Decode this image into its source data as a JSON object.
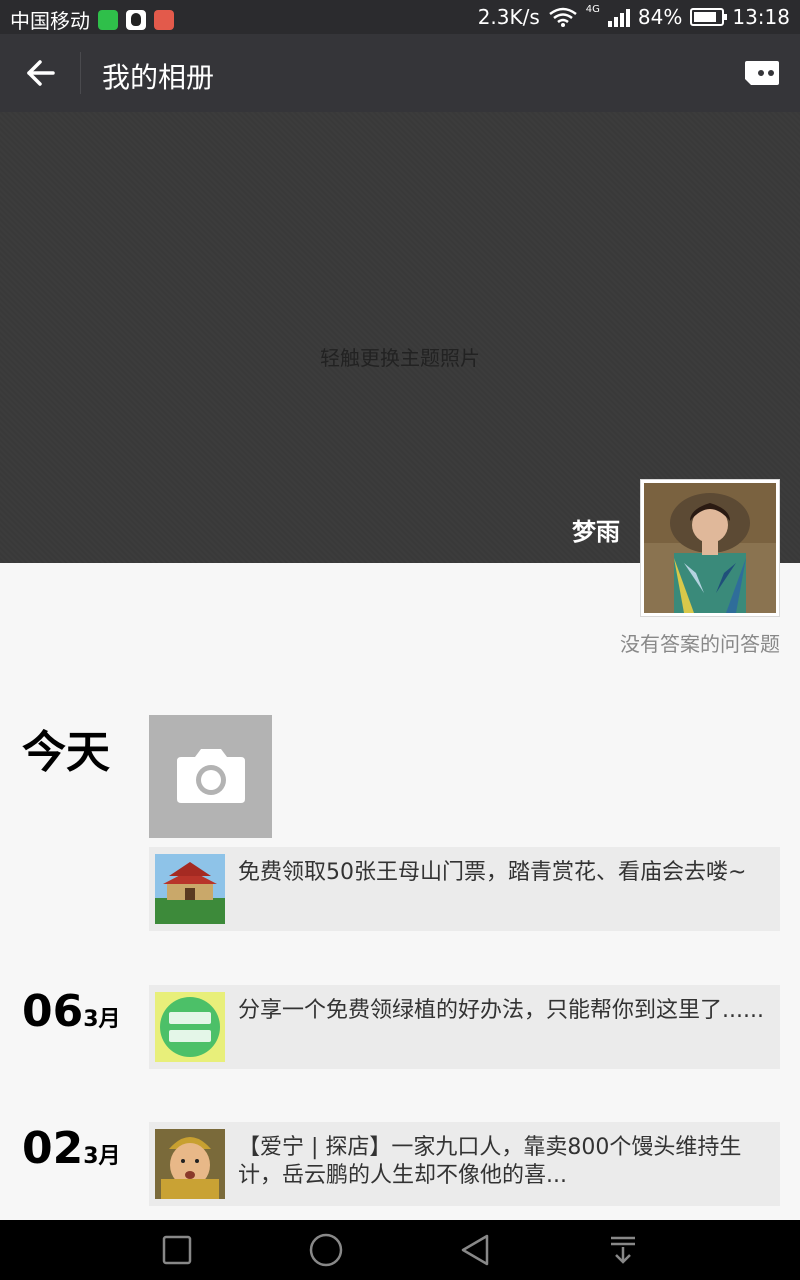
{
  "status_bar": {
    "carrier": "中国移动",
    "net_speed": "2.3K/s",
    "network_type": "4G",
    "battery": "84%",
    "battery_level": 0.84,
    "time": "13:18",
    "icons": [
      "app-green-icon",
      "qq-icon",
      "app-red-icon",
      "wifi-icon",
      "signal-icon",
      "battery-icon"
    ]
  },
  "action_bar": {
    "title": "我的相册",
    "back_icon": "back-arrow-icon",
    "more_icon": "more-chat-icon"
  },
  "cover": {
    "hint": "轻触更换主题照片",
    "username": "梦雨",
    "signature": "没有答案的问答题"
  },
  "timeline": {
    "today_label": "今天",
    "camera_icon": "camera-icon",
    "posts": [
      {
        "text": "免费领取50张王母山门票，踏青赏花、看庙会去喽~"
      },
      {
        "day": "06",
        "month": "3月",
        "text": "分享一个免费领绿植的好办法，只能帮你到这里了......"
      },
      {
        "day": "02",
        "month": "3月",
        "text": "【爱宁 | 探店】一家九口人，靠卖800个馒头维持生计，岳云鹏的人生却不像他的喜..."
      }
    ]
  },
  "nav_bar": {
    "icons": [
      "recent-apps-icon",
      "home-icon",
      "back-icon",
      "notification-pull-icon"
    ]
  }
}
